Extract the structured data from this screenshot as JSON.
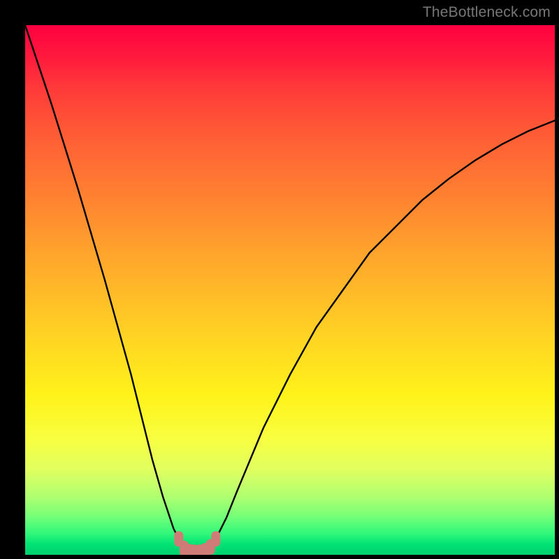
{
  "attribution": "TheBottleneck.com",
  "colors": {
    "frame": "#000000",
    "curve": "#000000",
    "marker": "#cf7b77",
    "gradient_top": "#ff0040",
    "gradient_bottom": "#00d06e"
  },
  "chart_data": {
    "type": "line",
    "title": "",
    "xlabel": "",
    "ylabel": "",
    "xlim": [
      0,
      100
    ],
    "ylim": [
      0,
      100
    ],
    "series": [
      {
        "name": "bottleneck-curve",
        "x": [
          0,
          5,
          10,
          15,
          20,
          22,
          24,
          26,
          28,
          29,
          30,
          31,
          32,
          33,
          34,
          35,
          36,
          38,
          40,
          45,
          50,
          55,
          60,
          65,
          70,
          75,
          80,
          85,
          90,
          95,
          100
        ],
        "values": [
          100,
          85,
          69,
          52,
          34,
          26,
          18,
          11,
          5,
          3,
          1.5,
          0.8,
          0.5,
          0.5,
          0.8,
          1.5,
          3,
          7,
          12,
          24,
          34,
          43,
          50,
          57,
          62,
          67,
          71,
          74.5,
          77.5,
          80,
          82
        ]
      }
    ],
    "markers": [
      {
        "x": 29.0,
        "y": 3.0
      },
      {
        "x": 30.0,
        "y": 1.2
      },
      {
        "x": 31.0,
        "y": 0.6
      },
      {
        "x": 32.0,
        "y": 0.5
      },
      {
        "x": 33.0,
        "y": 0.5
      },
      {
        "x": 34.0,
        "y": 0.8
      },
      {
        "x": 35.0,
        "y": 1.5
      },
      {
        "x": 36.0,
        "y": 3.0
      }
    ]
  }
}
